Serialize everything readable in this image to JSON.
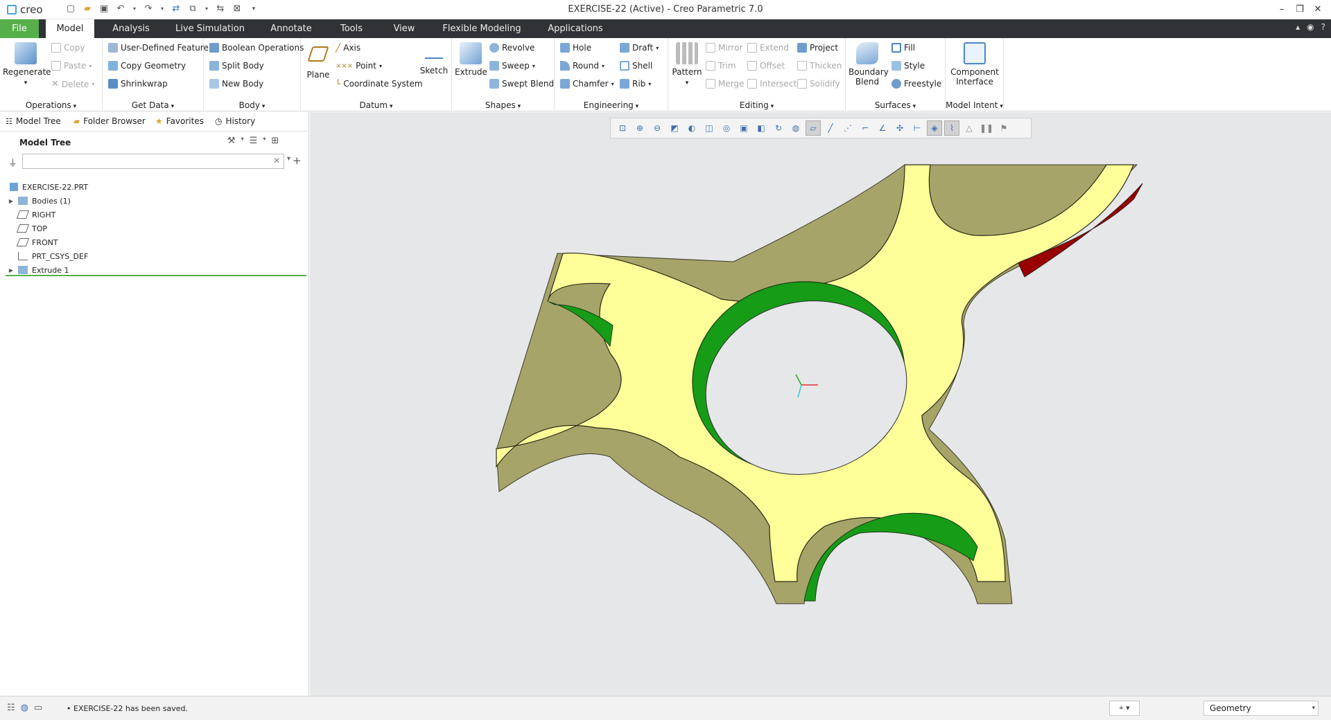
{
  "app": {
    "logo_text": "creo",
    "window_title": "EXERCISE-22 (Active) - Creo Parametric 7.0"
  },
  "tabs": [
    {
      "label": "File"
    },
    {
      "label": "Model"
    },
    {
      "label": "Analysis"
    },
    {
      "label": "Live Simulation"
    },
    {
      "label": "Annotate"
    },
    {
      "label": "Tools"
    },
    {
      "label": "View"
    },
    {
      "label": "Flexible Modeling"
    },
    {
      "label": "Applications"
    }
  ],
  "ribbon": {
    "operations": {
      "label": "Operations",
      "regenerate": "Regenerate",
      "copy": "Copy",
      "paste": "Paste",
      "delete": "Delete"
    },
    "get_data": {
      "label": "Get Data",
      "udf": "User-Defined Feature",
      "copy_geometry": "Copy Geometry",
      "shrinkwrap": "Shrinkwrap"
    },
    "body": {
      "label": "Body",
      "boolean": "Boolean Operations",
      "split": "Split Body",
      "new": "New Body"
    },
    "datum": {
      "label": "Datum",
      "plane": "Plane",
      "axis": "Axis",
      "point": "Point",
      "csys": "Coordinate System",
      "sketch": "Sketch"
    },
    "shapes": {
      "label": "Shapes",
      "extrude": "Extrude",
      "revolve": "Revolve",
      "sweep": "Sweep",
      "swept_blend": "Swept Blend"
    },
    "engineering": {
      "label": "Engineering",
      "hole": "Hole",
      "round": "Round",
      "chamfer": "Chamfer",
      "draft": "Draft",
      "shell": "Shell",
      "rib": "Rib"
    },
    "editing": {
      "label": "Editing",
      "pattern": "Pattern",
      "mirror": "Mirror",
      "trim": "Trim",
      "merge": "Merge",
      "extend": "Extend",
      "offset": "Offset",
      "intersect": "Intersect",
      "project": "Project",
      "thicken": "Thicken",
      "solidify": "Solidify"
    },
    "surfaces": {
      "label": "Surfaces",
      "boundary_blend_1": "Boundary",
      "boundary_blend_2": "Blend",
      "fill": "Fill",
      "style": "Style",
      "freestyle": "Freestyle"
    },
    "model_intent": {
      "label": "Model Intent",
      "component_1": "Component",
      "component_2": "Interface"
    }
  },
  "nav_tabs": [
    {
      "label": "Model Tree"
    },
    {
      "label": "Folder Browser"
    },
    {
      "label": "Favorites"
    },
    {
      "label": "History"
    }
  ],
  "model_tree": {
    "header": "Model Tree",
    "filter_value": "",
    "items": [
      {
        "label": "EXERCISE-22.PRT",
        "expandable": false
      },
      {
        "label": "Bodies (1)",
        "expandable": true
      },
      {
        "label": "RIGHT",
        "expandable": false
      },
      {
        "label": "TOP",
        "expandable": false
      },
      {
        "label": "FRONT",
        "expandable": false
      },
      {
        "label": "PRT_CSYS_DEF",
        "expandable": false
      },
      {
        "label": "Extrude 1",
        "expandable": true
      }
    ]
  },
  "status": {
    "message": "EXERCISE-22 has been saved.",
    "selection_filter": "Geometry"
  },
  "colors": {
    "file_tab": "#56b04a",
    "tab_strip": "#2f3338",
    "part_top": "#ffff99",
    "part_side": "#9c9b5e",
    "highlight_green": "#169c16",
    "highlight_red": "#990000",
    "viewport_bg": "#e6e7e8"
  }
}
